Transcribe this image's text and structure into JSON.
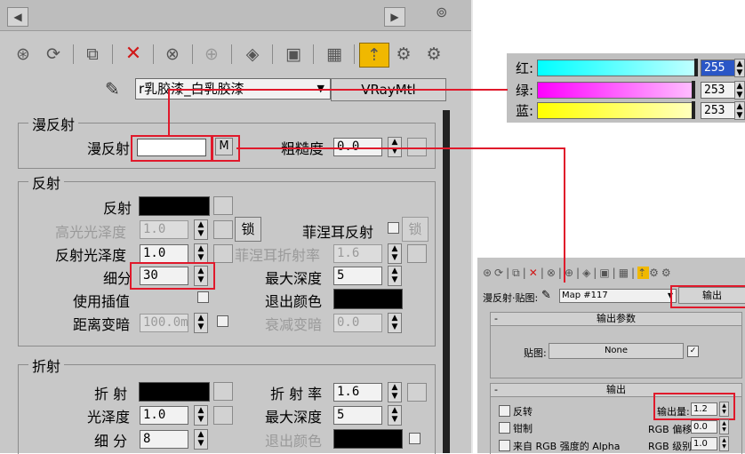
{
  "toolbar_icons": [
    "sphere-icon",
    "backlight-icon",
    "background-icon",
    "delete-icon",
    "uv-tiling-icon",
    "video-check-icon",
    "make-preview-icon",
    "options-icon",
    "material-id-icon",
    "show-map-icon",
    "show-end-result-icon",
    "go-parent-icon",
    "go-sibling-icon"
  ],
  "material": {
    "name": "r乳胶漆_白乳胶漆",
    "type_button": "VRayMtl"
  },
  "diffuse_group": {
    "title": "漫反射",
    "diffuse_label": "漫反射",
    "map_button": "M",
    "roughness_label": "粗糙度",
    "roughness_value": "0.0"
  },
  "reflection_group": {
    "title": "反射",
    "reflect_label": "反射",
    "hilight_gloss_label": "高光光泽度",
    "hilight_gloss_value": "1.0",
    "lock_label": "锁",
    "fresnel_label": "菲涅耳反射",
    "fresnel_lock_label": "锁",
    "refl_gloss_label": "反射光泽度",
    "refl_gloss_value": "1.0",
    "fresnel_ior_label": "菲涅耳折射率",
    "fresnel_ior_value": "1.6",
    "subdivs_label": "细分",
    "subdivs_value": "30",
    "max_depth_label": "最大深度",
    "max_depth_value": "5",
    "use_interp_label": "使用插值",
    "exit_color_label": "退出颜色",
    "dim_distance_label": "距离变暗",
    "dim_distance_value": "100.0m",
    "dim_falloff_label": "衰减变暗",
    "dim_falloff_value": "0.0"
  },
  "refraction_group": {
    "title": "折射",
    "refract_label": "折 射",
    "ior_label": "折 射 率",
    "ior_value": "1.6",
    "gloss_label": "光泽度",
    "gloss_value": "1.0",
    "max_depth_label": "最大深度",
    "max_depth_value": "5",
    "subdivs_label": "细 分",
    "subdivs_value": "8",
    "exit_color_label": "退出颜色"
  },
  "color_picker": {
    "rows": [
      {
        "label": "红:",
        "value": "255",
        "bar_from": "#00ffff",
        "bar_to": "#ffffff"
      },
      {
        "label": "绿:",
        "value": "253",
        "bar_from": "#ff00ff",
        "bar_to": "#ffffff"
      },
      {
        "label": "蓝:",
        "value": "253",
        "bar_from": "#ffff00",
        "bar_to": "#ffffff"
      }
    ]
  },
  "output_editor": {
    "slot_label": "漫反射·贴图:",
    "map_name": "Map #117",
    "output_button": "输出",
    "output_params_title": "输出参数",
    "bitmap_label": "贴图:",
    "bitmap_value": "None",
    "output_title": "输出",
    "invert_label": "反转",
    "clamp_label": "钳制",
    "alpha_label": "来自 RGB 强度的 Alpha",
    "output_amount_label": "输出量:",
    "output_amount_value": "1.2",
    "rgb_offset_label": "RGB 偏移:",
    "rgb_offset_value": "0.0",
    "rgb_level_label": "RGB 级别:",
    "rgb_level_value": "1.0",
    "rollout_toggle": "-"
  },
  "colors": {
    "accent_red": "#e0192b",
    "diffuse_swatch": "#ffffff",
    "reflect_swatch": "#000000",
    "refract_swatch": "#000000"
  }
}
